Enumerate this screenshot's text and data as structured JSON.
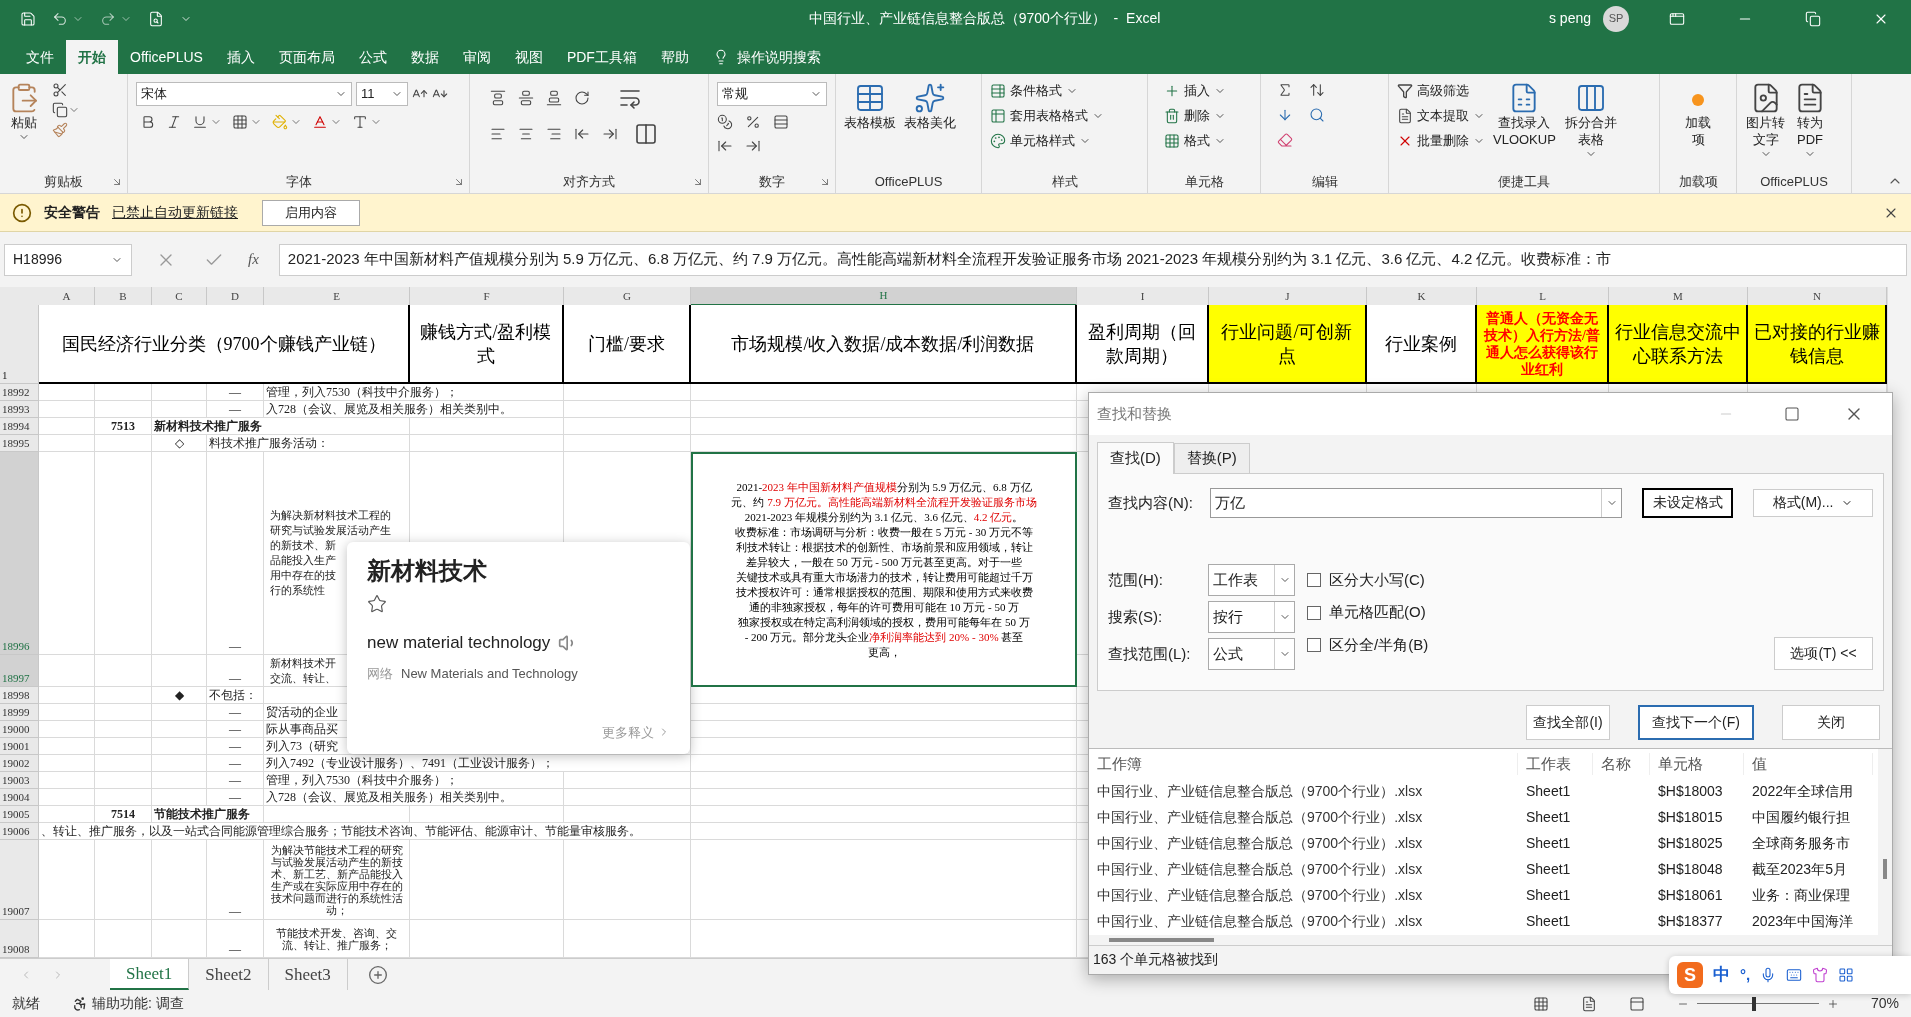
{
  "title_bar": {
    "title": "中国行业、产业链信息整合版总（9700个行业）  -  Excel",
    "user": "s peng",
    "avatar": "SP"
  },
  "ribbon_tabs": [
    {
      "label": "文件",
      "selected": false
    },
    {
      "label": "开始",
      "selected": true
    },
    {
      "label": "OfficePLUS",
      "selected": false
    },
    {
      "label": "插入",
      "selected": false
    },
    {
      "label": "页面布局",
      "selected": false
    },
    {
      "label": "公式",
      "selected": false
    },
    {
      "label": "数据",
      "selected": false
    },
    {
      "label": "审阅",
      "selected": false
    },
    {
      "label": "视图",
      "selected": false
    },
    {
      "label": "PDF工具箱",
      "selected": false
    },
    {
      "label": "帮助",
      "selected": false
    }
  ],
  "tell_me": "操作说明搜索",
  "ribbon": {
    "clipboard": {
      "paste": "粘贴",
      "group": "剪贴板"
    },
    "font": {
      "name": "宋体",
      "size": "11",
      "group": "字体"
    },
    "alignment": {
      "group": "对齐方式"
    },
    "number": {
      "format": "常规",
      "group": "数字"
    },
    "officeplus": {
      "buttons": [
        "表格模板",
        "表格美化"
      ],
      "group": "OfficePLUS"
    },
    "styles": {
      "buttons": [
        "条件格式",
        "套用表格格式",
        "单元格样式"
      ],
      "group": "样式"
    },
    "cells": {
      "buttons": [
        "插入",
        "删除",
        "格式"
      ],
      "group": "单元格"
    },
    "editing": {
      "group": "编辑"
    },
    "tools": {
      "rows": [
        "高级筛选",
        "文本提取",
        "批量删除"
      ],
      "large": [
        "查找录入\nVLOOKUP",
        "拆分合并表格"
      ],
      "group": "便捷工具"
    },
    "addins": {
      "button": "加载项",
      "group": "加载项"
    },
    "officeplus2": {
      "buttons": [
        "图片转文字",
        "转为\nPDF"
      ],
      "group": "OfficePLUS"
    }
  },
  "security_bar": {
    "title": "安全警告",
    "message": "已禁止自动更新链接",
    "button": "启用内容"
  },
  "formula_bar": {
    "name_box": "H18996",
    "function_label": "fx",
    "formula": "2021-2023 年中国新材料产值规模分别为 5.9 万亿元、6.8 万亿元、约 7.9 万亿元。高性能高端新材料全流程开发验证服务市场 2021-2023 年规模分别约为 3.1 亿元、3.6 亿元、4.2 亿元。收费标准：市"
  },
  "columns": [
    {
      "label": "A",
      "selected": false
    },
    {
      "label": "B",
      "selected": false
    },
    {
      "label": "C",
      "selected": false
    },
    {
      "label": "D",
      "selected": false
    },
    {
      "label": "E",
      "selected": false
    },
    {
      "label": "F",
      "selected": false
    },
    {
      "label": "G",
      "selected": false
    },
    {
      "label": "H",
      "selected": true
    },
    {
      "label": "I",
      "selected": false
    },
    {
      "label": "J",
      "selected": false
    },
    {
      "label": "K",
      "selected": false
    },
    {
      "label": "L",
      "selected": false
    },
    {
      "label": "M",
      "selected": false
    },
    {
      "label": "N",
      "selected": false
    }
  ],
  "header_row": {
    "number": "1",
    "cells": [
      {
        "text": "国民经济行业分类（9700个赚钱产业链）",
        "highlighted": false,
        "red": false
      },
      {
        "text": "赚钱方式/盈利模式",
        "highlighted": false,
        "red": false
      },
      {
        "text": "门槛/要求",
        "highlighted": false,
        "red": false
      },
      {
        "text": "市场规模/收入数据/成本数据/利润数据",
        "highlighted": false,
        "red": false
      },
      {
        "text": "盈利周期（回款周期）",
        "highlighted": false,
        "red": false
      },
      {
        "text": "行业问题/可创新点",
        "highlighted": true,
        "red": false
      },
      {
        "text": "行业案例",
        "highlighted": false,
        "red": false
      },
      {
        "text": "普通人（无资金无技术）入行方法/普通人怎么获得该行业红利",
        "highlighted": true,
        "red": true
      },
      {
        "text": "行业信息交流中心联系方法",
        "highlighted": true,
        "red": false
      },
      {
        "text": "已对接的行业赚钱信息",
        "highlighted": true,
        "red": false
      }
    ]
  },
  "rows": [
    {
      "number": "18992",
      "selected": false,
      "kind": "normal",
      "D": "—",
      "E": "管理，列入7530（科技中介服务）；"
    },
    {
      "number": "18993",
      "selected": false,
      "kind": "normal",
      "D": "—",
      "E": "入728（会议、展览及相关服务）相关类别中。"
    },
    {
      "number": "18994",
      "selected": false,
      "kind": "section",
      "B": "7513",
      "C": "新材料技术推广服务"
    },
    {
      "number": "18995",
      "selected": false,
      "kind": "normal",
      "C": "◇",
      "D": "料技术推广服务活动："
    },
    {
      "number": "18996",
      "selected": true,
      "kind": "normal",
      "D": "—",
      "E": [
        "为解决新材料技术工程的",
        "研究与试验发展活动产生",
        "的新技术、新",
        "品能投入生产",
        "用中存在的技",
        "行的系统性"
      ],
      "H": {
        "active": true,
        "lines": [
          [
            {
              "text": "2021-",
              "red": false
            },
            {
              "text": "2023 年中国新材料产值规模",
              "red": true
            },
            {
              "text": "分别为 5.9 万亿元、6.8 万亿",
              "red": false
            }
          ],
          [
            {
              "text": "元、约 ",
              "red": false
            },
            {
              "text": "7.9 万亿元。高性能高端新材料全流程开发验证服务市场",
              "red": true
            }
          ],
          [
            {
              "text": "2021-2023 年规模分别约为 3.1 亿元、3.6 亿元、",
              "red": false
            },
            {
              "text": "4.2 亿元",
              "red": true
            },
            {
              "text": "。",
              "red": false
            }
          ],
          [
            {
              "text": "收费标准：市场调研与分析：收费一般在 5 万元 - 30 万元不等",
              "red": false
            }
          ],
          [
            {
              "text": "利技术转让：根据技术的创新性、市场前景和应用领域，转让",
              "red": false
            }
          ],
          [
            {
              "text": "差异较大，一般在 50 万元 - 500 万元甚至更高。对于一些",
              "red": false
            }
          ],
          [
            {
              "text": "关键技术或具有重大市场潜力的技术，转让费用可能超过千万",
              "red": false
            }
          ],
          [
            {
              "text": "技术授权许可：通常根据授权的范围、期限和使用方式来收费",
              "red": false
            }
          ],
          [
            {
              "text": "通的非独家授权，每年的许可费用可能在 10 万元 - 50 万",
              "red": false
            }
          ],
          [
            {
              "text": "独家授权或在特定高利润领域的授权，费用可能每年在 50 万",
              "red": false
            }
          ],
          [
            {
              "text": "- 200 万元。部分龙头企业",
              "red": false
            },
            {
              "text": "净利润率能达到 20% - 30%",
              "red": true
            },
            {
              "text": " 甚至",
              "red": false
            }
          ],
          [
            {
              "text": "更高，",
              "red": false
            }
          ]
        ]
      }
    },
    {
      "number": "18997",
      "selected": true,
      "kind": "normal",
      "D": "—",
      "E": [
        "新材料技术开",
        "交流、转让、"
      ]
    },
    {
      "number": "18998",
      "selected": false,
      "kind": "normal",
      "C": "◆",
      "D": "不包括："
    },
    {
      "number": "18999",
      "selected": false,
      "kind": "normal",
      "D": "—",
      "E": "贸活动的企业"
    },
    {
      "number": "19000",
      "selected": false,
      "kind": "normal",
      "D": "—",
      "E": "际从事商品买"
    },
    {
      "number": "19001",
      "selected": false,
      "kind": "normal",
      "D": "—",
      "E": "列入73（研究"
    },
    {
      "number": "19002",
      "selected": false,
      "kind": "normal",
      "D": "—",
      "E": "列入7492（专业设计服务）、7491（工业设计服务）；"
    },
    {
      "number": "19003",
      "selected": false,
      "kind": "normal",
      "D": "—",
      "E": "管理，列入7530（科技中介服务）；"
    },
    {
      "number": "19004",
      "selected": false,
      "kind": "normal",
      "D": "—",
      "E": "入728（会议、展览及相关服务）相关类别中。"
    },
    {
      "number": "19005",
      "selected": false,
      "kind": "section",
      "B": "7514",
      "C": "节能技术推广服务"
    },
    {
      "number": "19006",
      "selected": false,
      "kind": "normal",
      "A": "、转让、推广服务，以及一站式合同能源管理综合服务；节能技术咨询、节能评估、能源审计、节能量审核服务。"
    },
    {
      "number": "19007",
      "selected": false,
      "kind": "normal",
      "D": "—",
      "E": [
        "为解决节能技术工程的研究与试验发展活动产生的新技术、新工艺、新产品能投入生产或在实际应用中存在的技术问题而进行的系统性活动；"
      ]
    },
    {
      "number": "19008",
      "selected": false,
      "kind": "normal",
      "D": "—",
      "E": [
        "节能技术开发、咨询、交流、转让、推广服务；"
      ]
    }
  ],
  "dictionary_popup": {
    "term": "新材料技术",
    "translation": "new material technology",
    "source": "网络",
    "source_translation": "New Materials and Technology",
    "more": "更多释义"
  },
  "find_dialog": {
    "title": "查找和替换",
    "tabs": [
      {
        "label": "查找(D)",
        "selected": true
      },
      {
        "label": "替换(P)",
        "selected": false
      }
    ],
    "find_label": "查找内容(N):",
    "find_value": "万亿",
    "no_format": "未设定格式",
    "format_button": "格式(M)...",
    "selects": [
      {
        "label": "范围(H):",
        "value": "工作表"
      },
      {
        "label": "搜索(S):",
        "value": "按行"
      },
      {
        "label": "查找范围(L):",
        "value": "公式"
      }
    ],
    "checkboxes": [
      {
        "label": "区分大小写(C)",
        "checked": false
      },
      {
        "label": "单元格匹配(O)",
        "checked": false
      },
      {
        "label": "区分全/半角(B)",
        "checked": false
      }
    ],
    "options_button": "选项(T) <<",
    "buttons": [
      "查找全部(I)",
      "查找下一个(F)",
      "关闭"
    ],
    "results_columns": [
      "工作簿",
      "工作表",
      "名称",
      "单元格",
      "值"
    ],
    "results": [
      {
        "workbook": "中国行业、产业链信息整合版总（9700个行业）.xlsx",
        "sheet": "Sheet1",
        "cell": "$H$18003",
        "value": "2022年全球信用"
      },
      {
        "workbook": "中国行业、产业链信息整合版总（9700个行业）.xlsx",
        "sheet": "Sheet1",
        "cell": "$H$18015",
        "value": "中国履约银行担"
      },
      {
        "workbook": "中国行业、产业链信息整合版总（9700个行业）.xlsx",
        "sheet": "Sheet1",
        "cell": "$H$18025",
        "value": "全球商务服务市"
      },
      {
        "workbook": "中国行业、产业链信息整合版总（9700个行业）.xlsx",
        "sheet": "Sheet1",
        "cell": "$H$18048",
        "value": "截至2023年5月"
      },
      {
        "workbook": "中国行业、产业链信息整合版总（9700个行业）.xlsx",
        "sheet": "Sheet1",
        "cell": "$H$18061",
        "value": "业务：商业保理"
      },
      {
        "workbook": "中国行业、产业链信息整合版总（9700个行业）.xlsx",
        "sheet": "Sheet1",
        "cell": "$H$18377",
        "value": "2023年中国海洋"
      }
    ],
    "status": "163 个单元格被找到"
  },
  "sheet_tabs": [
    {
      "label": "Sheet1",
      "selected": true
    },
    {
      "label": "Sheet2",
      "selected": false
    },
    {
      "label": "Sheet3",
      "selected": false
    }
  ],
  "status_bar": {
    "ready": "就绪",
    "accessibility": "辅助功能: 调查",
    "zoom": {
      "level": 0.45,
      "reading": "70%"
    }
  },
  "ime_toolbar": {
    "logo": "S",
    "mode": "中",
    "punctuation": "°,"
  }
}
